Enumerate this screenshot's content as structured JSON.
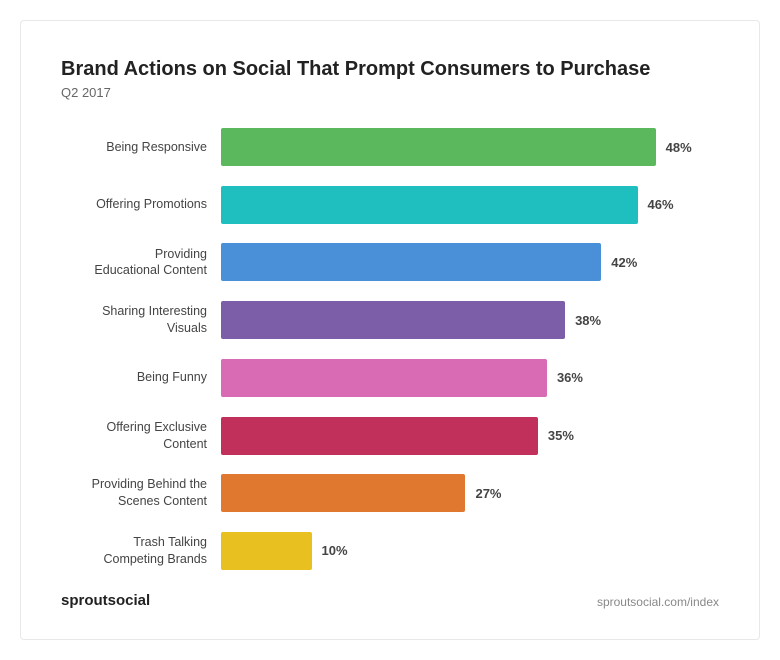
{
  "chart": {
    "title": "Brand Actions on Social That Prompt Consumers to Purchase",
    "subtitle": "Q2 2017",
    "bars": [
      {
        "label": "Being Responsive",
        "pct": 48,
        "display": "48%",
        "color": "#5cb85c",
        "colorHex": "#5cb85c"
      },
      {
        "label": "Offering Promotions",
        "pct": 46,
        "display": "46%",
        "color": "#20bfbf",
        "colorHex": "#20bfbf"
      },
      {
        "label": "Providing\nEducational Content",
        "pct": 42,
        "display": "42%",
        "color": "#4a90d9",
        "colorHex": "#4a90d9"
      },
      {
        "label": "Sharing Interesting\nVisuals",
        "pct": 38,
        "display": "38%",
        "color": "#7b5ea7",
        "colorHex": "#7b5ea7"
      },
      {
        "label": "Being Funny",
        "pct": 36,
        "display": "36%",
        "color": "#d96bb5",
        "colorHex": "#d96bb5"
      },
      {
        "label": "Offering Exclusive\nContent",
        "pct": 35,
        "display": "35%",
        "color": "#c0305a",
        "colorHex": "#c0305a"
      },
      {
        "label": "Providing Behind the\nScenes Content",
        "pct": 27,
        "display": "27%",
        "color": "#e07830",
        "colorHex": "#e07830"
      },
      {
        "label": "Trash Talking\nCompeting Brands",
        "pct": 10,
        "display": "10%",
        "color": "#e8c020",
        "colorHex": "#e8c020"
      }
    ],
    "maxPct": 55
  },
  "footer": {
    "logo_prefix": "sprout",
    "logo_bold": "social",
    "url": "sproutsocial.com/index"
  }
}
